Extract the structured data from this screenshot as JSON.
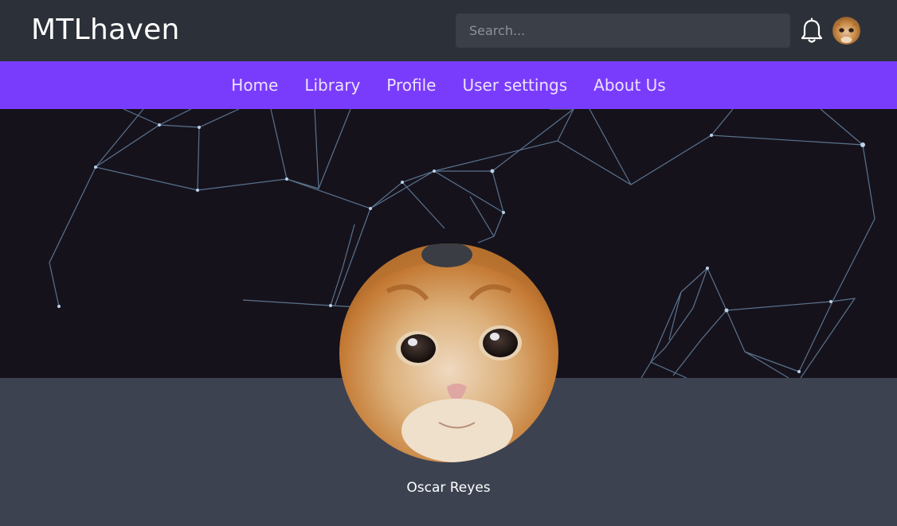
{
  "header": {
    "brand": "MTLhaven",
    "search_placeholder": "Search...",
    "notification_icon": "bell-icon",
    "user_avatar": "cat-avatar"
  },
  "nav": {
    "items": [
      {
        "label": "Home"
      },
      {
        "label": "Library"
      },
      {
        "label": "Profile"
      },
      {
        "label": "User settings"
      },
      {
        "label": "About Us"
      }
    ]
  },
  "profile": {
    "name": "Oscar Reyes",
    "banner": "network-constellation-banner",
    "avatar": "crying-cat-avatar"
  },
  "colors": {
    "topbar_bg": "#2c3038",
    "nav_bg": "#7a3cfc",
    "banner_bg": "#16121c",
    "page_bg": "#3c4250"
  }
}
